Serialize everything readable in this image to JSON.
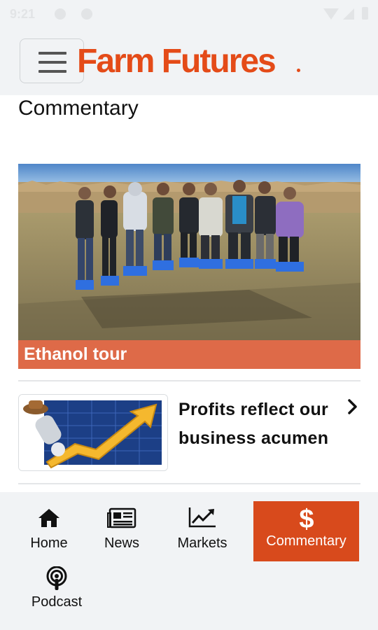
{
  "status_bar": {
    "time": "9:21"
  },
  "header": {
    "logo_text": "Farm Futures",
    "brand_color": "#e44b18"
  },
  "page": {
    "title": "Commentary"
  },
  "featured": {
    "caption": "Ethanol tour",
    "caption_bg": "#de6a48"
  },
  "articles": [
    {
      "title_line1": "Profits reflect our",
      "title_line2": "business acumen"
    }
  ],
  "bottom_nav": {
    "items": [
      {
        "label": "Home",
        "icon": "home-icon"
      },
      {
        "label": "News",
        "icon": "newspaper-icon"
      },
      {
        "label": "Markets",
        "icon": "chart-trend-icon"
      },
      {
        "label": "Commentary",
        "icon": "dollar-icon",
        "active": true
      },
      {
        "label": "Podcast",
        "icon": "podcast-icon"
      }
    ],
    "active_color": "#d84a1c"
  }
}
